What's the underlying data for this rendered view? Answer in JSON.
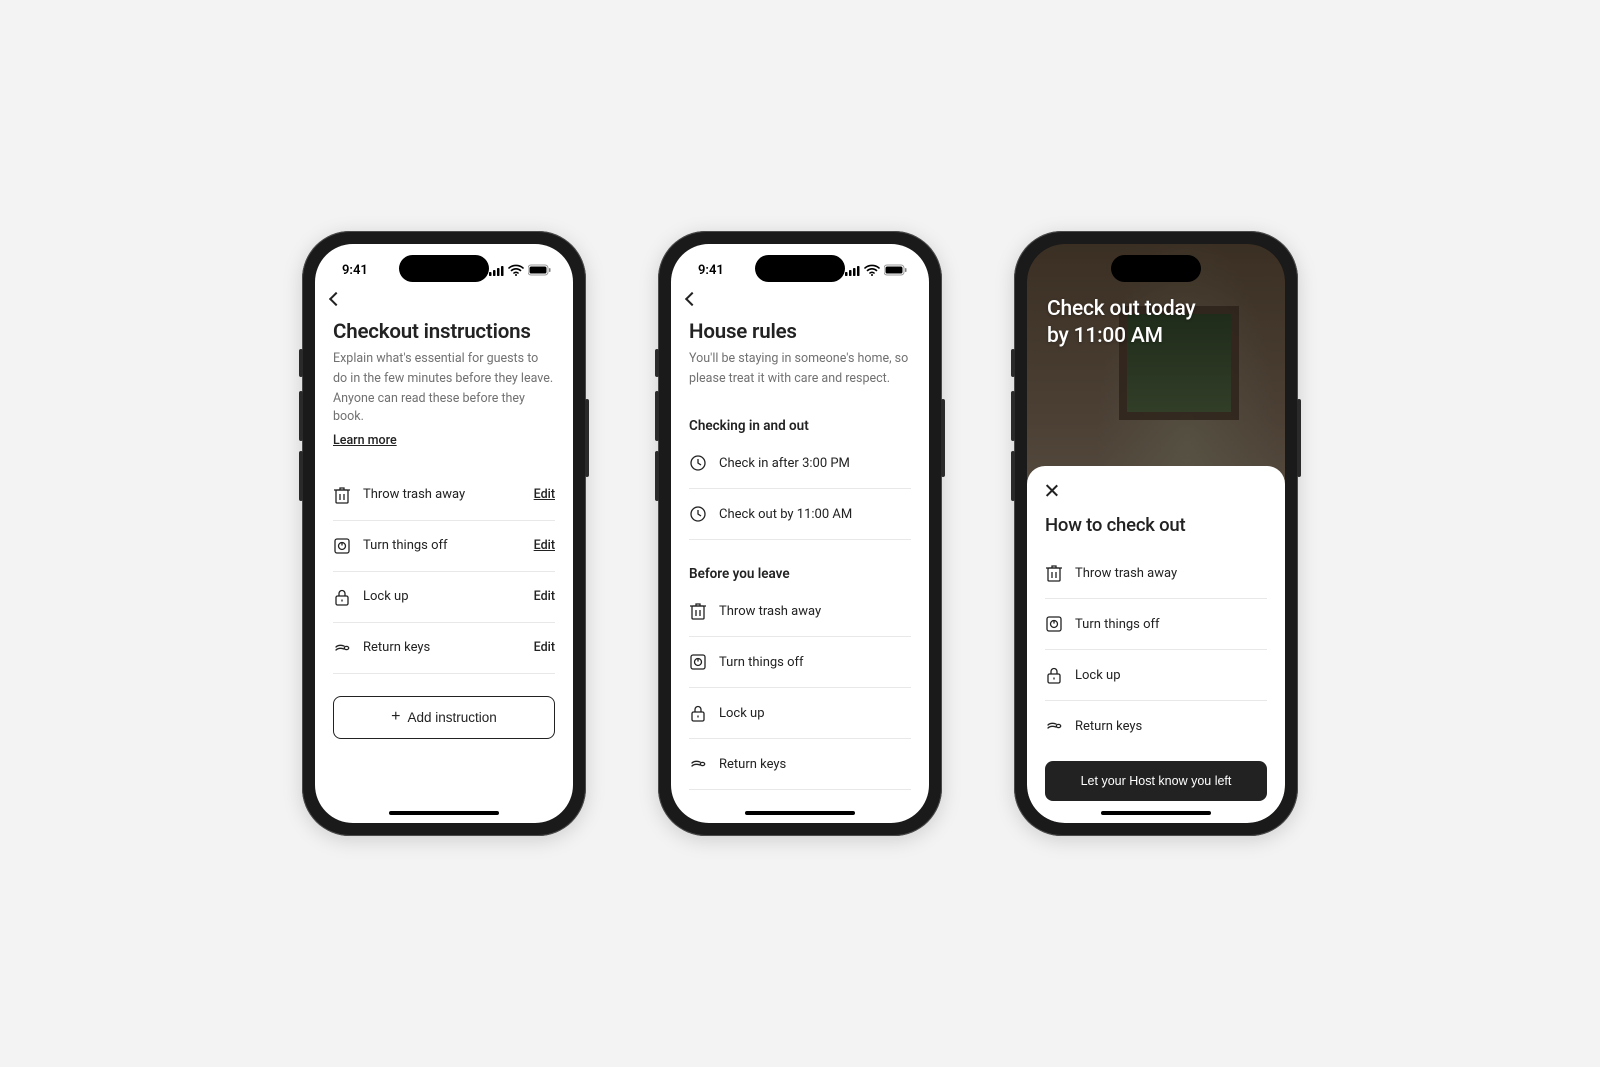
{
  "status": {
    "time": "9:41"
  },
  "p1": {
    "title": "Checkout instructions",
    "sub1": "Explain what's essential for guests to",
    "sub2": "do in the few minutes before they leave.",
    "sub3": "Anyone can read these before they book.",
    "learn": "Learn more",
    "items": [
      {
        "label": "Throw trash away",
        "edit": "Edit",
        "underlined": true
      },
      {
        "label": "Turn things off",
        "edit": "Edit",
        "underlined": true
      },
      {
        "label": "Lock up",
        "edit": "Edit",
        "underlined": false
      },
      {
        "label": "Return keys",
        "edit": "Edit",
        "underlined": false
      }
    ],
    "add": "Add instruction"
  },
  "p2": {
    "title": "House rules",
    "sub1": "You'll be staying in someone's home, so",
    "sub2": "please treat it with care and respect.",
    "sec1": "Checking in and out",
    "checkin": "Check in after 3:00 PM",
    "checkout": "Check out by 11:00 AM",
    "sec2": "Before you leave",
    "items": [
      "Throw trash away",
      "Turn things off",
      "Lock up",
      "Return keys"
    ]
  },
  "p3": {
    "overlay1": "Check out today",
    "overlay2": "by 11:00 AM",
    "sheet_title": "How to check out",
    "items": [
      "Throw trash away",
      "Turn things off",
      "Lock up",
      "Return keys"
    ],
    "cta": "Let your Host know you left"
  }
}
